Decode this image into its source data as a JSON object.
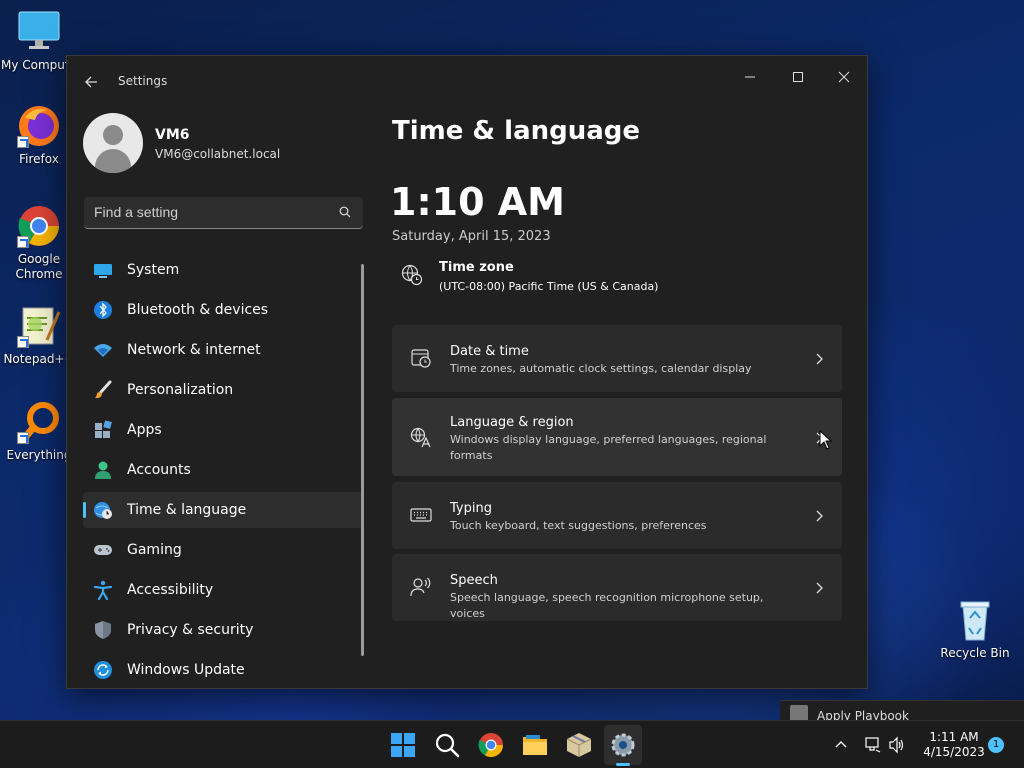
{
  "desktop": {
    "icons": [
      {
        "label": "My Comput"
      },
      {
        "label": "Firefox"
      },
      {
        "label": "Google Chrome"
      },
      {
        "label": "Notepad++"
      },
      {
        "label": "Everything"
      },
      {
        "label": "Recycle Bin"
      }
    ]
  },
  "window": {
    "title": "Settings",
    "controls": {
      "minimize": "—",
      "maximize": "☐",
      "close": "✕"
    }
  },
  "profile": {
    "name": "VM6",
    "email": "VM6@collabnet.local"
  },
  "search": {
    "placeholder": "Find a setting"
  },
  "nav": {
    "items": [
      {
        "label": "System"
      },
      {
        "label": "Bluetooth & devices"
      },
      {
        "label": "Network & internet"
      },
      {
        "label": "Personalization"
      },
      {
        "label": "Apps"
      },
      {
        "label": "Accounts"
      },
      {
        "label": "Time & language"
      },
      {
        "label": "Gaming"
      },
      {
        "label": "Accessibility"
      },
      {
        "label": "Privacy & security"
      },
      {
        "label": "Windows Update"
      }
    ],
    "active": "Time & language"
  },
  "main": {
    "title": "Time & language",
    "time": "1:10 AM",
    "date": "Saturday, April 15, 2023",
    "timezone": {
      "label": "Time zone",
      "value": "(UTC-08:00) Pacific Time (US & Canada)"
    },
    "cards": [
      {
        "title": "Date & time",
        "subtitle": "Time zones, automatic clock settings, calendar display"
      },
      {
        "title": "Language & region",
        "subtitle": "Windows display language, preferred languages, regional formats"
      },
      {
        "title": "Typing",
        "subtitle": "Touch keyboard, text suggestions, preferences"
      },
      {
        "title": "Speech",
        "subtitle": "Speech language, speech recognition microphone setup, voices"
      }
    ]
  },
  "taskbar": {
    "time": "1:11 AM",
    "date": "4/15/2023",
    "notification_count": "1"
  },
  "toast": {
    "text": "Apply Playbook"
  },
  "colors": {
    "accent": "#4cc2ff",
    "window_bg": "#202020",
    "card_bg": "#2b2b2b"
  }
}
